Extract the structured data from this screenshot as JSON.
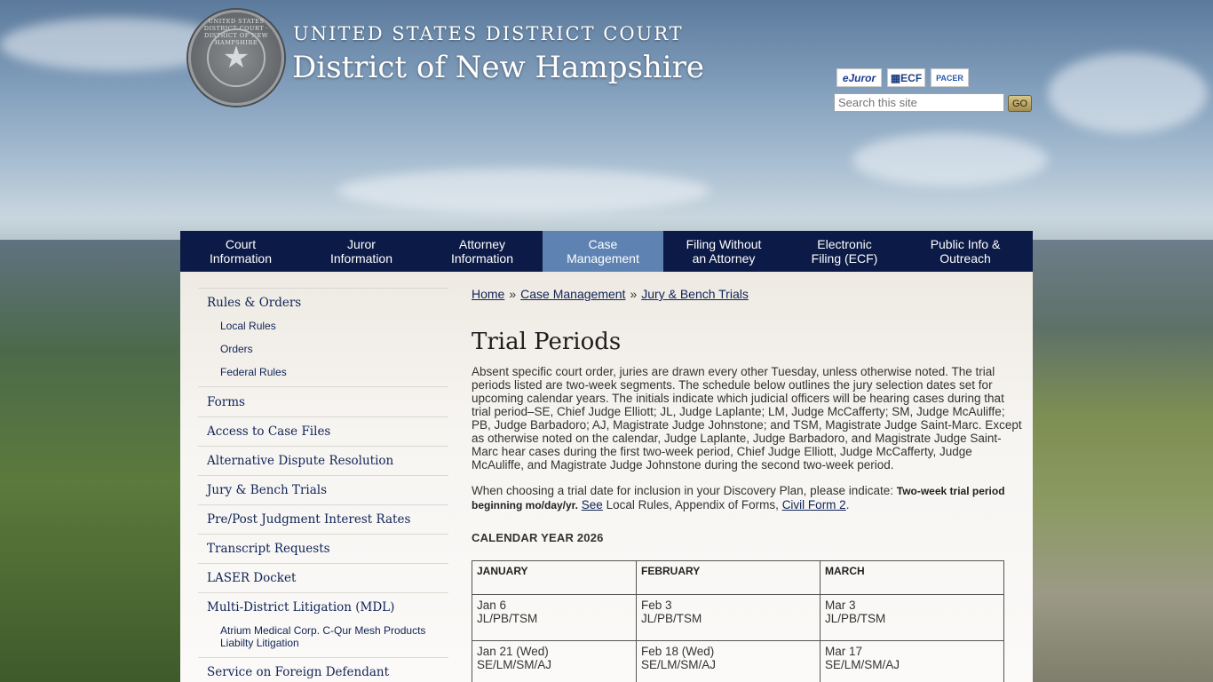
{
  "header": {
    "court_label": "UNITED STATES DISTRICT COURT",
    "district_title": "District of New Hampshire",
    "seal_text": "UNITED STATES DISTRICT COURT · DISTRICT OF NEW HAMPSHIRE"
  },
  "quick_links": {
    "ejuror": "eJuror",
    "ecf": "ECF",
    "pacer": "PACER"
  },
  "search": {
    "placeholder": "Search this site",
    "go": "GO"
  },
  "nav": [
    {
      "label": "Court\nInformation"
    },
    {
      "label": "Juror\nInformation"
    },
    {
      "label": "Attorney\nInformation"
    },
    {
      "label": "Case\nManagement"
    },
    {
      "label": "Filing Without\nan Attorney"
    },
    {
      "label": "Electronic\nFiling (ECF)"
    },
    {
      "label": "Public Info &\nOutreach"
    }
  ],
  "sidebar": {
    "rules_orders": "Rules & Orders",
    "rules_sub": [
      "Local Rules",
      "Orders",
      "Federal Rules"
    ],
    "items": [
      "Forms",
      "Access to Case Files",
      "Alternative Dispute Resolution",
      "Jury & Bench Trials",
      "Pre/Post Judgment Interest Rates",
      "Transcript Requests",
      "LASER Docket"
    ],
    "mdl": "Multi-District Litigation (MDL)",
    "mdl_sub": "Atrium Medical Corp. C-Qur Mesh Products Liabilty Litigation",
    "service": "Service on Foreign Defendant"
  },
  "breadcrumb": {
    "home": "Home",
    "sep": "»",
    "case_management": "Case Management",
    "current": "Jury & Bench Trials"
  },
  "page": {
    "title": "Trial Periods",
    "intro": "Absent specific court order, juries are drawn every other Tuesday, unless otherwise noted. The trial periods listed are two-week segments. The schedule below outlines the jury selection dates set for upcoming calendar years. The initials indicate which judicial officers will be hearing cases during that trial period–SE, Chief Judge Elliott; JL, Judge Laplante; LM, Judge McCafferty; SM, Judge McAuliffe; PB, Judge Barbadoro; AJ, Magistrate Judge Johnstone; and TSM, Magistrate Judge Saint-Marc. Except as otherwise noted on the calendar, Judge Laplante, Judge Barbadoro, and Magistrate Judge Saint-Marc hear cases during the first two-week period, Chief Judge Elliott, Judge McCafferty, Judge McAuliffe, and Magistrate Judge Johnstone during the second two-week period.",
    "choose_prefix": "When choosing a trial date for inclusion in your Discovery Plan, please indicate: ",
    "choose_bold": "Two-week trial period beginning mo/day/yr.",
    "see": "See",
    "see_text": " Local Rules, Appendix of Forms, ",
    "civil_form": "Civil Form 2",
    "period": ".",
    "calendar_heading": "CALENDAR YEAR 2026"
  },
  "calendar": {
    "months": [
      "JANUARY",
      "FEBRUARY",
      "MARCH"
    ],
    "rows": [
      [
        {
          "date": "Jan 6",
          "judges": "JL/PB/TSM"
        },
        {
          "date": "Feb 3",
          "judges": "JL/PB/TSM"
        },
        {
          "date": "Mar 3",
          "judges": "JL/PB/TSM"
        }
      ],
      [
        {
          "date": "Jan 21 (Wed)",
          "judges": "SE/LM/SM/AJ"
        },
        {
          "date": "Feb 18 (Wed)",
          "judges": "SE/LM/SM/AJ"
        },
        {
          "date": "Mar 17",
          "judges": "SE/LM/SM/AJ"
        }
      ]
    ]
  }
}
